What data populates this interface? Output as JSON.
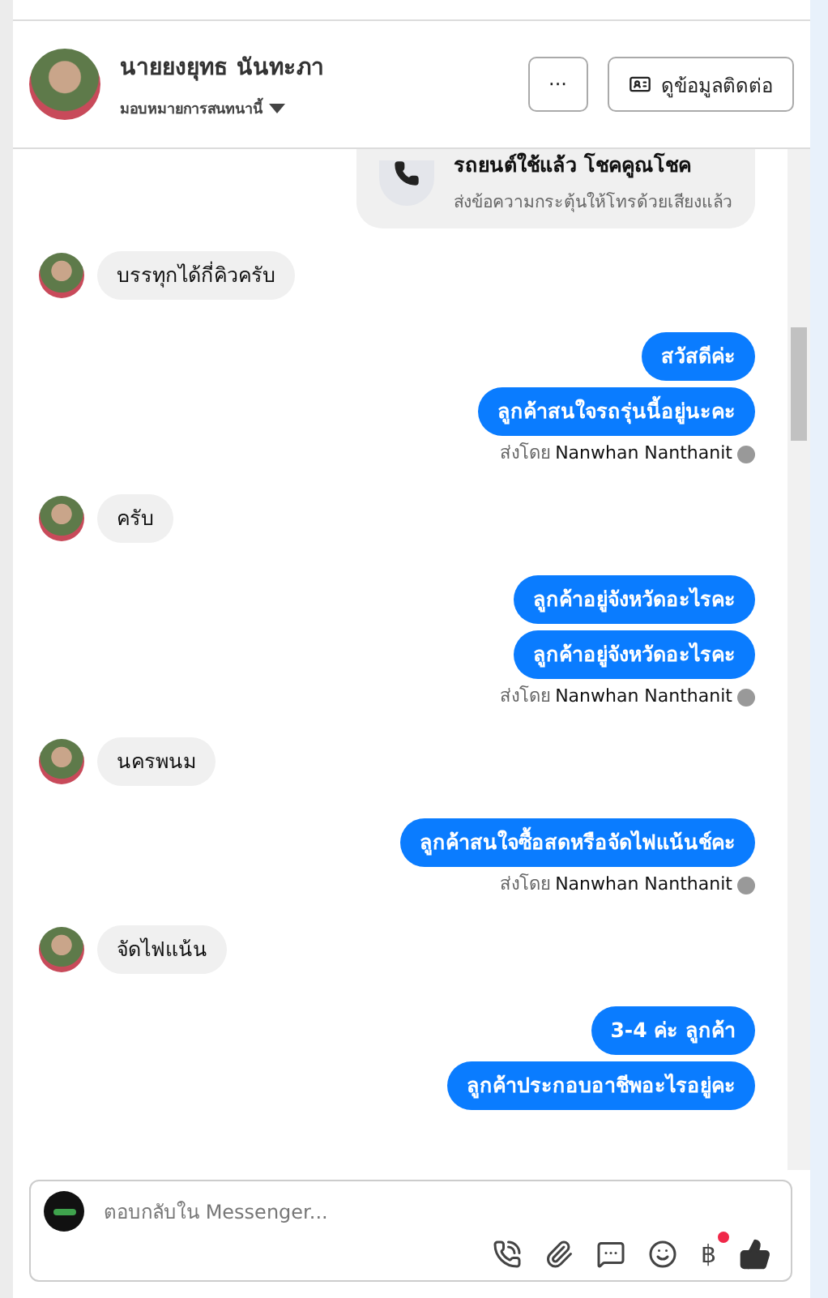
{
  "header": {
    "name": "นายยงยุทธ นันทะภา",
    "assign": "มอบหมายการสนทนานี้",
    "more_button": "···",
    "contact_button": "ดูข้อมูลติดต่อ"
  },
  "messages": [
    {
      "kind": "call_card",
      "title": "รถยนต์ใช้แล้ว โชคคูณโชค",
      "text": "ส่งข้อความกระตุ้นให้โทรด้วยเสียงแล้ว"
    },
    {
      "kind": "received",
      "text": "บรรทุกได้กี่คิวครับ"
    },
    {
      "kind": "sent",
      "text": "สวัสดีค่ะ"
    },
    {
      "kind": "sent",
      "text": "ลูกค้าสนใจรถรุ่นนี้อยู่นะคะ"
    },
    {
      "kind": "sent_by",
      "prefix": "ส่งโดย",
      "name": "Nanwhan Nanthanit"
    },
    {
      "kind": "received",
      "text": "ครับ"
    },
    {
      "kind": "sent",
      "text": "ลูกค้าอยู่จังหวัดอะไรคะ"
    },
    {
      "kind": "sent",
      "text": "ลูกค้าอยู่จังหวัดอะไรคะ"
    },
    {
      "kind": "sent_by",
      "prefix": "ส่งโดย",
      "name": "Nanwhan Nanthanit"
    },
    {
      "kind": "received",
      "text": "นครพนม"
    },
    {
      "kind": "sent",
      "text": "ลูกค้าสนใจซื้อสดหรือจัดไฟแน้นช์คะ"
    },
    {
      "kind": "sent_by",
      "prefix": "ส่งโดย",
      "name": "Nanwhan Nanthanit"
    },
    {
      "kind": "received",
      "text": "จัดไฟแน้น"
    },
    {
      "kind": "sent",
      "text": "3-4 ค่ะ ลูกค้า"
    },
    {
      "kind": "sent",
      "text": "ลูกค้าประกอบอาชีพอะไรอยู่คะ"
    }
  ],
  "composer": {
    "placeholder": "ตอบกลับใน Messenger...",
    "baht": "฿",
    "notification_dot": true
  }
}
